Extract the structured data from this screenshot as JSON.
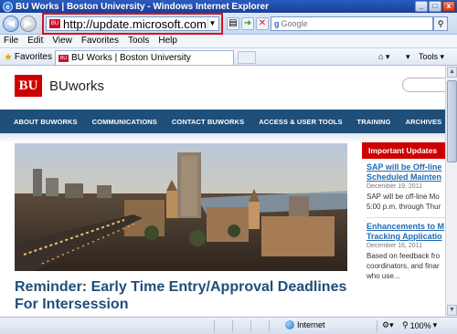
{
  "window": {
    "title": "BU Works | Boston University - Windows Internet Explorer",
    "controls": [
      "_",
      "□",
      "x"
    ]
  },
  "address": {
    "url": "http://update.microsoft.com"
  },
  "search": {
    "placeholder": "Google"
  },
  "menu": {
    "items": [
      "File",
      "Edit",
      "View",
      "Favorites",
      "Tools",
      "Help"
    ]
  },
  "favorites_bar": {
    "favorites_label": "Favorites",
    "tab_label": "BU Works | Boston University",
    "tools_label": "Tools"
  },
  "site": {
    "logo_text": "BU",
    "name": "BUworks",
    "nav": [
      "ABOUT BUWORKS",
      "COMMUNICATIONS",
      "CONTACT BUWORKS",
      "ACCESS & USER TOOLS",
      "TRAINING",
      "ARCHIVES"
    ],
    "headline": "Reminder: Early Time Entry/Approval Deadlines For Intersession",
    "updates": {
      "heading": "Important Updates",
      "items": [
        {
          "title_1": "SAP will be Off-line",
          "title_2": "Scheduled Mainten",
          "date": "December 19, 2011",
          "text_1": "SAP will be off-line Mo",
          "text_2": "5:00 p.m. through Thur"
        },
        {
          "title_1": "Enhancements to M",
          "title_2": "Tracking Applicatio",
          "date": "December 16, 2011",
          "text_1": "Based on feedback fro",
          "text_2": "coordinators, and finar",
          "text_3": "who use..."
        }
      ]
    }
  },
  "status": {
    "zone": "Internet",
    "zoom": "100%"
  },
  "colors": {
    "bu_red": "#cc0000",
    "nav_blue": "#1f4e79",
    "link_blue": "#1f6bb5",
    "highlight_red": "#d9121b"
  }
}
